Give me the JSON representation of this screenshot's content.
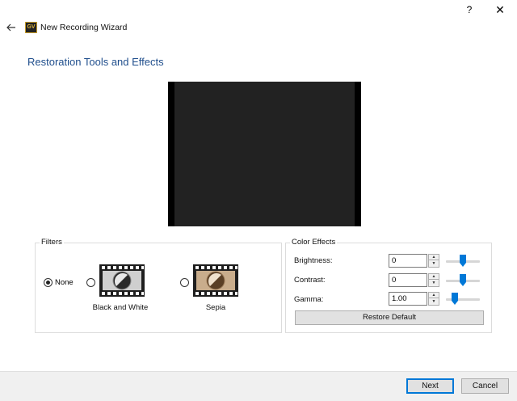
{
  "window": {
    "title": "New Recording Wizard",
    "logo_text": "GV",
    "help_label": "?",
    "close_label": "✕"
  },
  "page": {
    "title": "Restoration Tools and Effects"
  },
  "filters": {
    "group_label": "Filters",
    "options": [
      {
        "label": "None",
        "selected": true
      },
      {
        "label": "Black and White",
        "selected": false
      },
      {
        "label": "Sepia",
        "selected": false
      }
    ]
  },
  "color_effects": {
    "group_label": "Color Effects",
    "brightness": {
      "label": "Brightness:",
      "value": "0",
      "slider_level": 0.5
    },
    "contrast": {
      "label": "Contrast:",
      "value": "0",
      "slider_level": 0.5
    },
    "gamma": {
      "label": "Gamma:",
      "value": "1.00",
      "slider_level": 0.2
    },
    "restore_label": "Restore Default"
  },
  "footer": {
    "next_label": "Next",
    "cancel_label": "Cancel"
  },
  "colors": {
    "accent": "#0078d7",
    "title_blue": "#1f4e8c",
    "slider_thumb": "#0078d7"
  },
  "icons": {
    "back": "back-arrow-icon",
    "help": "help-icon",
    "close": "close-icon",
    "bw_filter": "film-black-white-icon",
    "sepia_filter": "film-sepia-icon"
  }
}
